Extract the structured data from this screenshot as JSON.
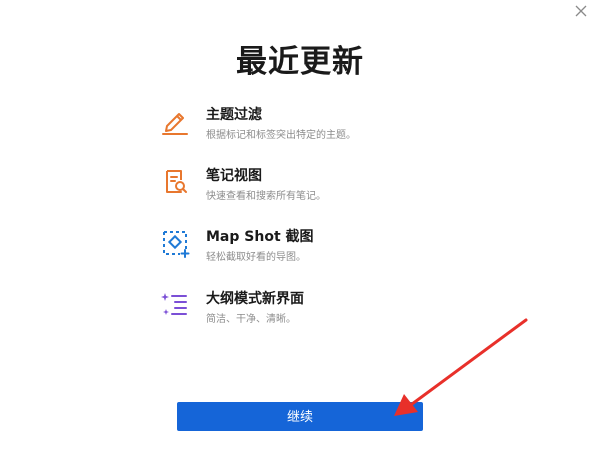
{
  "dialog": {
    "title": "最近更新",
    "close_icon": "close-icon"
  },
  "features": [
    {
      "icon": "pencil-filter-icon",
      "title": "主题过滤",
      "description": "根据标记和标签突出特定的主题。"
    },
    {
      "icon": "note-search-icon",
      "title": "笔记视图",
      "description": "快速查看和搜索所有笔记。"
    },
    {
      "icon": "screenshot-icon",
      "title": "Map Shot 截图",
      "description": "轻松截取好看的导图。"
    },
    {
      "icon": "outline-sparkle-icon",
      "title": "大纲模式新界面",
      "description": "简洁、干净、清晰。"
    }
  ],
  "continue_button": {
    "label": "继续"
  },
  "colors": {
    "accent": "#1565d8",
    "icon_orange": "#e8772e",
    "icon_blue": "#1f7ad6",
    "icon_purple": "#7b4fd6",
    "arrow_red": "#e8302a"
  }
}
